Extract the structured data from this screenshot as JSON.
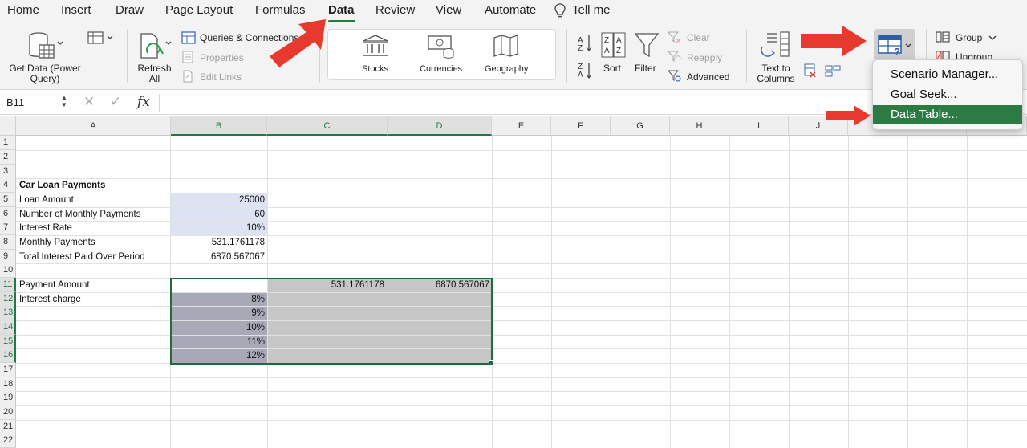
{
  "tabs": [
    {
      "label": "Home"
    },
    {
      "label": "Insert"
    },
    {
      "label": "Draw"
    },
    {
      "label": "Page Layout"
    },
    {
      "label": "Formulas"
    },
    {
      "label": "Data"
    },
    {
      "label": "Review"
    },
    {
      "label": "View"
    },
    {
      "label": "Automate"
    },
    {
      "label": "Tell me"
    }
  ],
  "active_tab": "Data",
  "ribbon": {
    "get_data": "Get Data (Power\nQuery)",
    "refresh_all": "Refresh\nAll",
    "queries_connections": "Queries & Connections",
    "properties": "Properties",
    "edit_links": "Edit Links",
    "stocks": "Stocks",
    "currencies": "Currencies",
    "geography": "Geography",
    "sort": "Sort",
    "filter": "Filter",
    "clear": "Clear",
    "reapply": "Reapply",
    "advanced": "Advanced",
    "text_to_columns": "Text to\nColumns",
    "group": "Group",
    "ungroup": "Ungroup"
  },
  "formula_bar": {
    "name_box": "B11",
    "fx": "fx"
  },
  "columns": [
    "A",
    "B",
    "C",
    "D",
    "E",
    "F",
    "G",
    "H",
    "I",
    "J"
  ],
  "rows": [
    "1",
    "2",
    "3",
    "4",
    "5",
    "6",
    "7",
    "8",
    "9",
    "10",
    "11",
    "12",
    "13",
    "14",
    "15",
    "16",
    "17",
    "18",
    "19",
    "20",
    "21",
    "22"
  ],
  "cells": {
    "a4": "Car Loan Payments",
    "a5": "Loan Amount",
    "b5": "25000",
    "a6": "Number of Monthly Payments",
    "b6": "60",
    "a7": "Interest Rate",
    "b7": "10%",
    "a8": "Monthly Payments",
    "b8": "531.1761178",
    "a9": "Total Interest Paid Over Period",
    "b9": "6870.567067",
    "a11": "Payment Amount",
    "c11": "531.1761178",
    "d11": "6870.567067",
    "a12": "Interest charge",
    "b12": "8%",
    "b13": "9%",
    "b14": "10%",
    "b15": "11%",
    "b16": "12%"
  },
  "what_if_menu": [
    {
      "label": "Scenario Manager..."
    },
    {
      "label": "Goal Seek..."
    },
    {
      "label": "Data Table..."
    }
  ],
  "colors": {
    "accent_green": "#1f7a45",
    "menu_highlight": "#2c7a44",
    "annotation_red": "#e8392e",
    "input_fill": "#dde3f3",
    "selection_fill": "#c6c6c6"
  }
}
